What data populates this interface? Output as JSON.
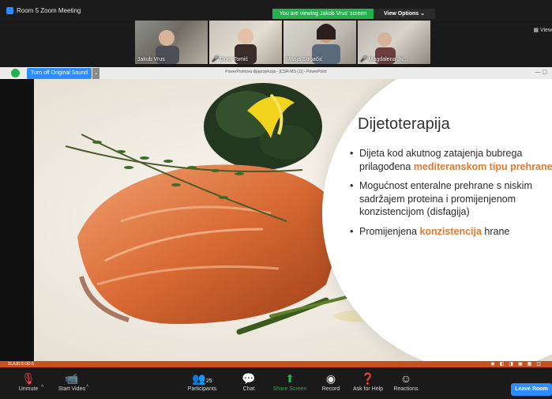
{
  "window": {
    "title": "Room 5  Zoom Meeting"
  },
  "banner": {
    "viewing": "You are viewing Jakob Vrus' screen",
    "view_options": "View Options ⌄"
  },
  "gallery": {
    "view_label": "View",
    "participants": [
      {
        "name": "Jakob Vrus",
        "muted": false
      },
      {
        "name": "Dora Tomić",
        "muted": true
      },
      {
        "name": "Marija Strgačić",
        "muted": false
      },
      {
        "name": "Magdalena Ju...",
        "muted": true
      }
    ]
  },
  "sharebar": {
    "original_sound": "Turn off Original Sound",
    "ppt_title": "PowerPointova dijaprojekcija - [CSR-MS (1)] - PowerPoint"
  },
  "slide": {
    "title": "Dijetoterapija",
    "b1_a": "Dijeta kod akutnog zatajenja bubrega prilagođena ",
    "b1_hl": "mediteranskom tipu prehrane",
    "b2": "Mogućnost enteralne prehrane s niskim sadržajem proteina i promijenjenom konzistencijom (disfagija)",
    "b3_a": "Promijenjena ",
    "b3_hl": "konzistencija",
    "b3_b": " hrane",
    "highlight_color": "#e07a2e"
  },
  "ppt_status": {
    "slide_label": "SLAJD 6 OD 6"
  },
  "controls": {
    "unmute": "Unmute",
    "start_video": "Start Video",
    "participants": "Participants",
    "participants_count": "25",
    "chat": "Chat",
    "share_screen": "Share Screen",
    "record": "Record",
    "ask_for_help": "Ask for Help",
    "reactions": "Reactions",
    "leave_room": "Leave Room"
  }
}
